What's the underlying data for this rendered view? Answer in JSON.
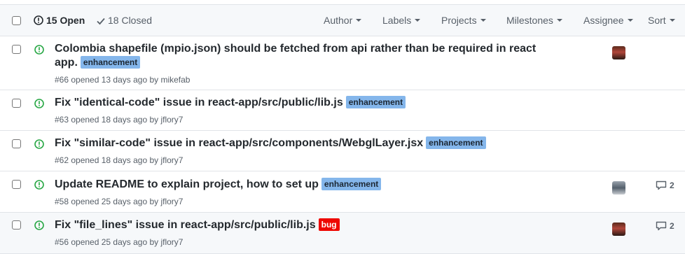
{
  "header": {
    "open_label": "15 Open",
    "closed_label": "18 Closed",
    "filters": [
      {
        "label": "Author"
      },
      {
        "label": "Labels"
      },
      {
        "label": "Projects"
      },
      {
        "label": "Milestones"
      },
      {
        "label": "Assignee"
      },
      {
        "label": "Sort"
      }
    ]
  },
  "issues": [
    {
      "title": "Colombia shapefile (mpio.json) should be fetched from api rather than be required in react app.",
      "labels": [
        {
          "name": "enhancement",
          "color": "#84b6eb"
        }
      ],
      "meta": "#66 opened 13 days ago by mikefab",
      "assignee_avatar": true,
      "comments": ""
    },
    {
      "title": "Fix \"identical-code\" issue in react-app/src/public/lib.js",
      "labels": [
        {
          "name": "enhancement",
          "color": "#84b6eb"
        }
      ],
      "meta": "#63 opened 18 days ago by jflory7",
      "assignee_avatar": false,
      "comments": ""
    },
    {
      "title": "Fix \"similar-code\" issue in react-app/src/components/WebglLayer.jsx",
      "labels": [
        {
          "name": "enhancement",
          "color": "#84b6eb"
        }
      ],
      "meta": "#62 opened 18 days ago by jflory7",
      "assignee_avatar": false,
      "comments": ""
    },
    {
      "title": "Update README to explain project, how to set up",
      "labels": [
        {
          "name": "enhancement",
          "color": "#84b6eb"
        }
      ],
      "meta": "#58 opened 25 days ago by jflory7",
      "assignee_avatar": true,
      "comments": "2"
    },
    {
      "title": "Fix \"file_lines\" issue in react-app/src/public/lib.js",
      "labels": [
        {
          "name": "bug",
          "color": "#ee0701"
        }
      ],
      "meta": "#56 opened 25 days ago by jflory7",
      "assignee_avatar": true,
      "comments": "2"
    }
  ],
  "icons": {
    "open_state": "issue-opened-icon",
    "closed_state": "check-icon",
    "comment": "comment-icon"
  },
  "colors": {
    "open_issue_green": "#28a745",
    "label_enhancement": "#84b6eb",
    "label_bug": "#ee0701"
  }
}
